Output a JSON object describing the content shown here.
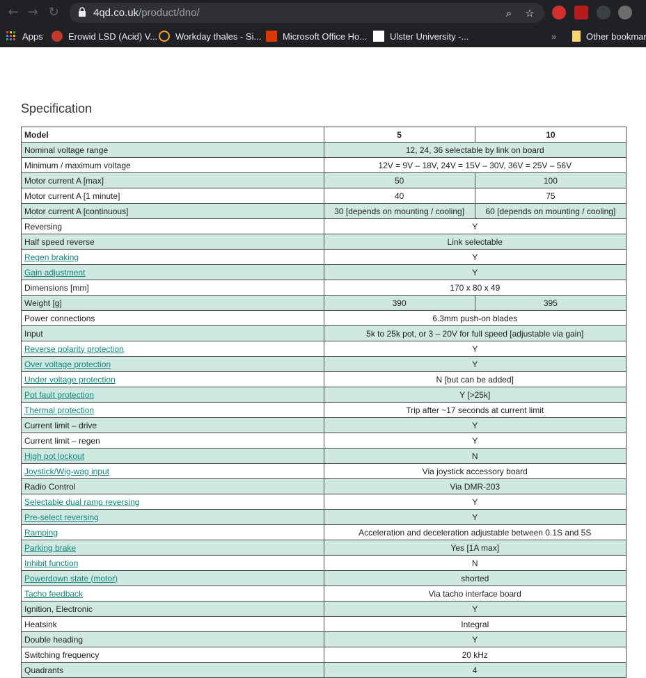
{
  "browser": {
    "url_host": "4qd.co.uk",
    "url_path": "/product/dno/",
    "bookmarks": [
      {
        "label": "Apps",
        "icon": "apps-grid-icon"
      },
      {
        "label": "Erowid LSD (Acid) V...",
        "icon": "erowid-icon"
      },
      {
        "label": "Workday thales - Si...",
        "icon": "workday-icon"
      },
      {
        "label": "Microsoft Office Ho...",
        "icon": "office-icon"
      },
      {
        "label": "Ulster University -...",
        "icon": "ulster-icon"
      }
    ],
    "overflow_label": "»",
    "other_bookmarks": "Other bookmarks"
  },
  "page": {
    "heading": "Specification",
    "header_row": {
      "label": "Model",
      "col1": "5",
      "col2": "10"
    },
    "rows": [
      {
        "label": "Nominal voltage range",
        "value": "12, 24, 36 selectable by link on board",
        "link": false
      },
      {
        "label": "Minimum / maximum voltage",
        "value": "12V = 9V – 18V, 24V = 15V – 30V, 36V = 25V – 56V",
        "link": false
      },
      {
        "label": "Motor current A [max]",
        "v1": "50",
        "v2": "100",
        "link": false
      },
      {
        "label": "Motor current A [1 minute]",
        "v1": "40",
        "v2": "75",
        "link": false
      },
      {
        "label": "Motor current A [continuous]",
        "v1": "30 [depends on mounting / cooling]",
        "v2": "60 [depends on mounting / cooling]",
        "link": false
      },
      {
        "label": "Reversing",
        "value": "Y",
        "link": false
      },
      {
        "label": "Half speed reverse",
        "value": "Link selectable",
        "link": false
      },
      {
        "label": "Regen braking",
        "value": "Y",
        "link": true
      },
      {
        "label": "Gain adjustment",
        "value": "Y",
        "link": true
      },
      {
        "label": "Dimensions [mm]",
        "value": "170 x 80 x 49",
        "link": false
      },
      {
        "label": "Weight [g]",
        "v1": "390",
        "v2": "395",
        "link": false
      },
      {
        "label": "Power connections",
        "value": "6.3mm push-on blades",
        "link": false
      },
      {
        "label": "Input",
        "value": "5k to 25k pot, or 3 – 20V for full speed [adjustable via gain]",
        "link": false
      },
      {
        "label": "Reverse polarity protection",
        "value": "Y",
        "link": true
      },
      {
        "label": "Over voltage protection",
        "value": "Y",
        "link": true
      },
      {
        "label": "Under voltage protection",
        "value": "N [but can be added]",
        "link": true
      },
      {
        "label": "Pot fault protection",
        "value": "Y [>25k]",
        "link": true
      },
      {
        "label": "Thermal protection",
        "value": "Trip after ~17 seconds at current limit",
        "link": true
      },
      {
        "label": "Current limit – drive",
        "value": "Y",
        "link": false
      },
      {
        "label": "Current limit – regen",
        "value": "Y",
        "link": false
      },
      {
        "label": "High pot lockout",
        "value": "N",
        "link": true
      },
      {
        "label": "Joystick/Wig-wag input",
        "value": "Via joystick accessory board",
        "link": true
      },
      {
        "label": "Radio Control",
        "value": "Via DMR-203",
        "link": false
      },
      {
        "label": "Selectable dual ramp reversing",
        "value": "Y",
        "link": true
      },
      {
        "label": "Pre-select reversing",
        "value": "Y",
        "link": true
      },
      {
        "label": "Ramping",
        "value": "Acceleration and deceleration adjustable between 0.1S and 5S",
        "link": true
      },
      {
        "label": "Parking brake",
        "value": "Yes [1A max]",
        "link": true
      },
      {
        "label": "Inhibit function",
        "value": "N",
        "link": true
      },
      {
        "label": "Powerdown state (motor)",
        "value": "shorted",
        "link": true
      },
      {
        "label": "Tacho feedback",
        "value": "Via tacho interface board",
        "link": true
      },
      {
        "label": "Ignition, Electronic",
        "value": "Y",
        "link": false
      },
      {
        "label": "Heatsink",
        "value": "Integral",
        "link": false
      },
      {
        "label": "Double heading",
        "value": "Y",
        "link": false
      },
      {
        "label": "Switching frequency",
        "value": "20 kHz",
        "link": false
      },
      {
        "label": "Quadrants",
        "value": "4",
        "link": false
      }
    ]
  }
}
